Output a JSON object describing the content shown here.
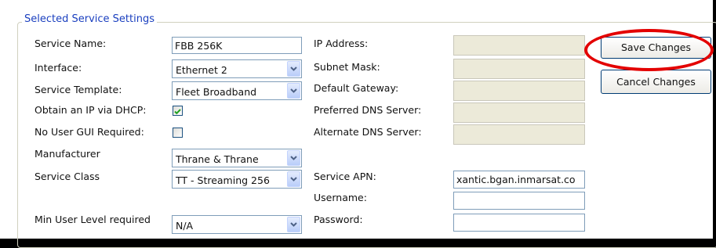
{
  "group": {
    "title": "Selected Service Settings"
  },
  "left": {
    "service_name": {
      "label": "Service Name:",
      "value": "FBB 256K"
    },
    "interface": {
      "label": "Interface:",
      "value": "Ethernet 2"
    },
    "service_template": {
      "label": "Service Template:",
      "value": "Fleet Broadband"
    },
    "dhcp": {
      "label": "Obtain an IP via DHCP:",
      "checked": true
    },
    "no_gui": {
      "label": "No User GUI Required:",
      "checked": false
    },
    "manufacturer": {
      "label": "Manufacturer",
      "value": "Thrane & Thrane"
    },
    "service_class": {
      "label": "Service Class",
      "value": "TT - Streaming 256"
    },
    "min_level": {
      "label": "Min User Level required",
      "value": "N/A"
    }
  },
  "right": {
    "ip": {
      "label": "IP Address:",
      "value": ""
    },
    "subnet": {
      "label": "Subnet Mask:",
      "value": ""
    },
    "gateway": {
      "label": "Default Gateway:",
      "value": ""
    },
    "dns1": {
      "label": "Preferred DNS Server:",
      "value": ""
    },
    "dns2": {
      "label": "Alternate DNS Server:",
      "value": ""
    },
    "apn": {
      "label": "Service APN:",
      "value": "xantic.bgan.inmarsat.co"
    },
    "username": {
      "label": "Username:",
      "value": ""
    },
    "password": {
      "label": "Password:",
      "value": ""
    }
  },
  "buttons": {
    "save": "Save Changes",
    "cancel": "Cancel Changes"
  },
  "colors": {
    "highlight_ring": "#e30000",
    "legend_text": "#1a3fbf"
  }
}
